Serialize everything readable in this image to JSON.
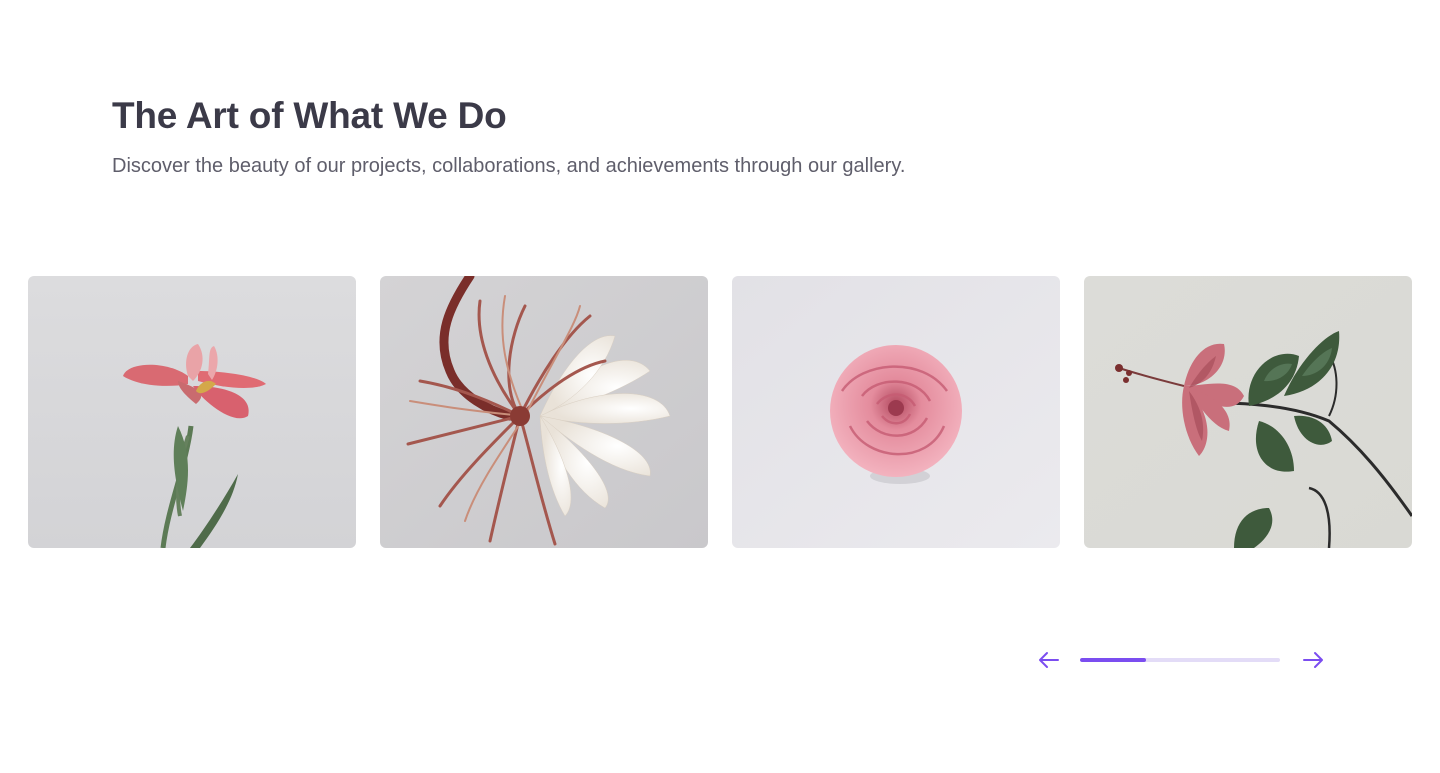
{
  "header": {
    "title": "The Art of What We Do",
    "subtitle": "Discover the beauty of our projects, collaborations, and achievements through our gallery."
  },
  "gallery": {
    "items": [
      {
        "subject": "pink-iris-flower-photo"
      },
      {
        "subject": "cream-cactus-flower-photo"
      },
      {
        "subject": "pink-rose-photo"
      },
      {
        "subject": "pink-hibiscus-branch-photo"
      }
    ]
  },
  "carousel": {
    "progress": 0.33,
    "prev_icon": "arrow-left-icon",
    "next_icon": "arrow-right-icon"
  },
  "colors": {
    "accent": "#7b4df0",
    "track": "#e3dcf7",
    "title": "#3b3a48",
    "subtitle": "#5f5e6b"
  }
}
